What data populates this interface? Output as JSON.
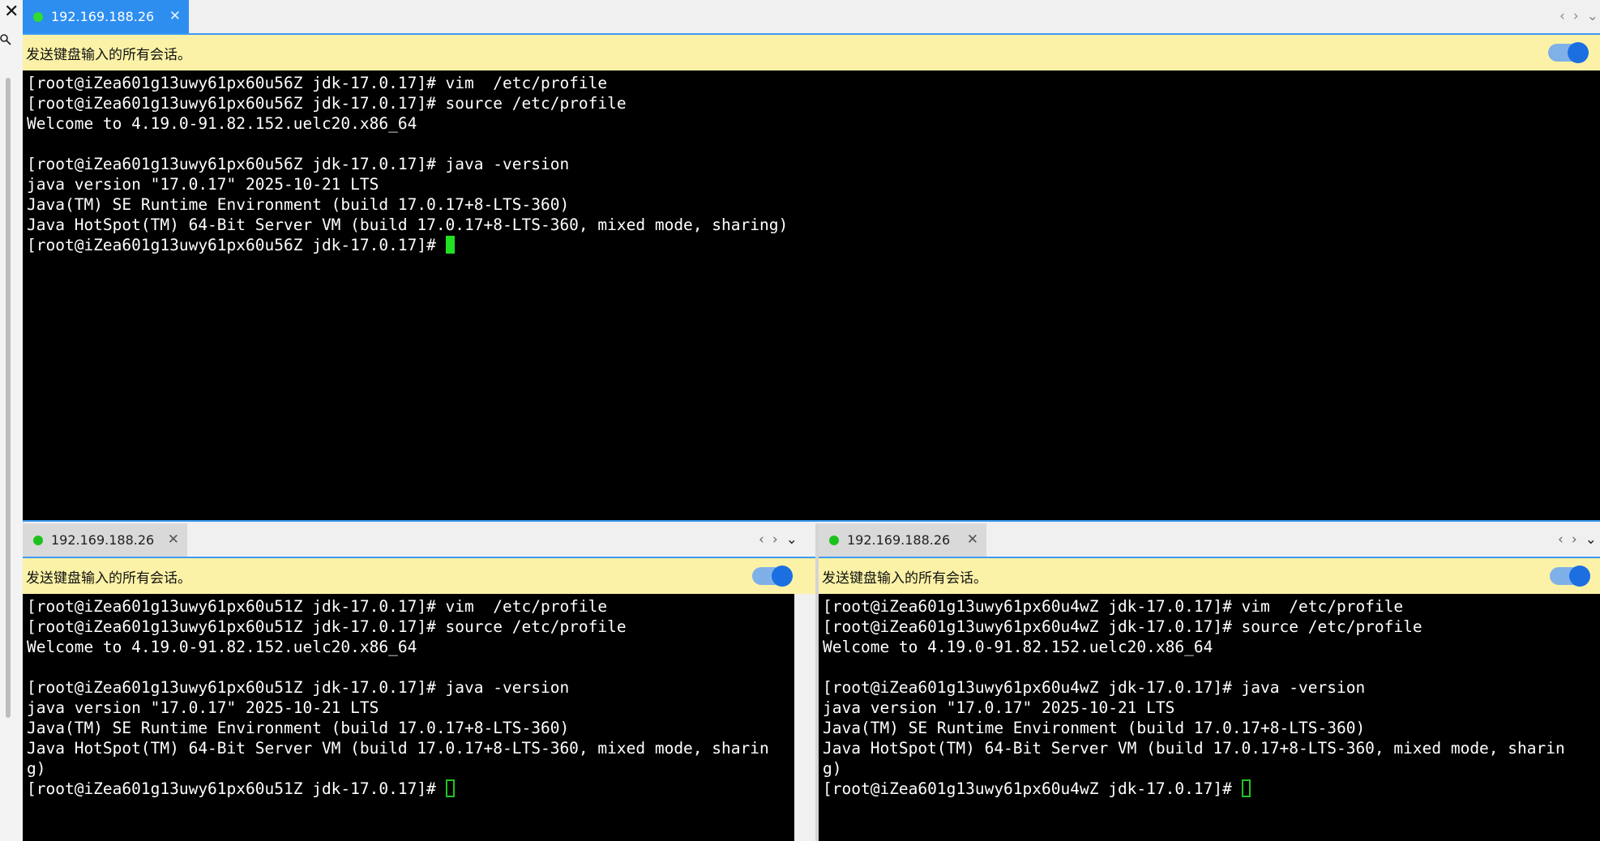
{
  "window": {
    "close_glyph": "✕"
  },
  "panes": [
    {
      "id": "top",
      "tab": {
        "host": "192.169.188.26",
        "close": "✕",
        "status_color": "#2fdc2f"
      },
      "nav": {
        "prev": "‹",
        "next": "›",
        "menu": "⌄"
      },
      "broadcast": {
        "label": "发送键盘输入的所有会话。",
        "enabled": true
      },
      "lines": [
        "[root@iZea601g13uwy61px60u56Z jdk-17.0.17]# vim  /etc/profile",
        "[root@iZea601g13uwy61px60u56Z jdk-17.0.17]# source /etc/profile",
        "Welcome to 4.19.0-91.82.152.uelc20.x86_64",
        "",
        "[root@iZea601g13uwy61px60u56Z jdk-17.0.17]# java -version",
        "java version \"17.0.17\" 2025-10-21 LTS",
        "Java(TM) SE Runtime Environment (build 17.0.17+8-LTS-360)",
        "Java HotSpot(TM) 64-Bit Server VM (build 17.0.17+8-LTS-360, mixed mode, sharing)"
      ],
      "prompt": "[root@iZea601g13uwy61px60u56Z jdk-17.0.17]# "
    },
    {
      "id": "bottom-left",
      "tab": {
        "host": "192.169.188.26",
        "close": "✕",
        "status_color": "#1cc21c"
      },
      "nav": {
        "prev": "‹",
        "next": "›",
        "menu": "⌄"
      },
      "broadcast": {
        "label": "发送键盘输入的所有会话。",
        "enabled": true
      },
      "lines": [
        "[root@iZea601g13uwy61px60u51Z jdk-17.0.17]# vim  /etc/profile",
        "[root@iZea601g13uwy61px60u51Z jdk-17.0.17]# source /etc/profile",
        "Welcome to 4.19.0-91.82.152.uelc20.x86_64",
        "",
        "[root@iZea601g13uwy61px60u51Z jdk-17.0.17]# java -version",
        "java version \"17.0.17\" 2025-10-21 LTS",
        "Java(TM) SE Runtime Environment (build 17.0.17+8-LTS-360)",
        "Java HotSpot(TM) 64-Bit Server VM (build 17.0.17+8-LTS-360, mixed mode, sharin",
        "g)"
      ],
      "prompt": "[root@iZea601g13uwy61px60u51Z jdk-17.0.17]# "
    },
    {
      "id": "bottom-right",
      "tab": {
        "host": "192.169.188.26",
        "close": "✕",
        "status_color": "#1cc21c"
      },
      "nav": {
        "prev": "‹",
        "next": "›",
        "menu": "⌄"
      },
      "broadcast": {
        "label": "发送键盘输入的所有会话。",
        "enabled": true
      },
      "lines": [
        "[root@iZea601g13uwy61px60u4wZ jdk-17.0.17]# vim  /etc/profile",
        "[root@iZea601g13uwy61px60u4wZ jdk-17.0.17]# source /etc/profile",
        "Welcome to 4.19.0-91.82.152.uelc20.x86_64",
        "",
        "[root@iZea601g13uwy61px60u4wZ jdk-17.0.17]# java -version",
        "java version \"17.0.17\" 2025-10-21 LTS",
        "Java(TM) SE Runtime Environment (build 17.0.17+8-LTS-360)",
        "Java HotSpot(TM) 64-Bit Server VM (build 17.0.17+8-LTS-360, mixed mode, sharin",
        "g)"
      ],
      "prompt": "[root@iZea601g13uwy61px60u4wZ jdk-17.0.17]# "
    }
  ],
  "icons": {
    "close": "close-icon",
    "search": "search-icon",
    "status": "status-dot-icon",
    "prev": "chevron-left-icon",
    "next": "chevron-right-icon",
    "menu": "chevron-down-icon",
    "toggle": "broadcast-toggle",
    "cursor": "terminal-cursor"
  },
  "colors": {
    "tab_active": "#2d8ef0",
    "tab_inactive": "#d9d9d9",
    "broadcast_bar": "#fbf2a7",
    "terminal_bg": "#000000",
    "terminal_fg": "#ffffff",
    "cursor": "#22e022"
  }
}
